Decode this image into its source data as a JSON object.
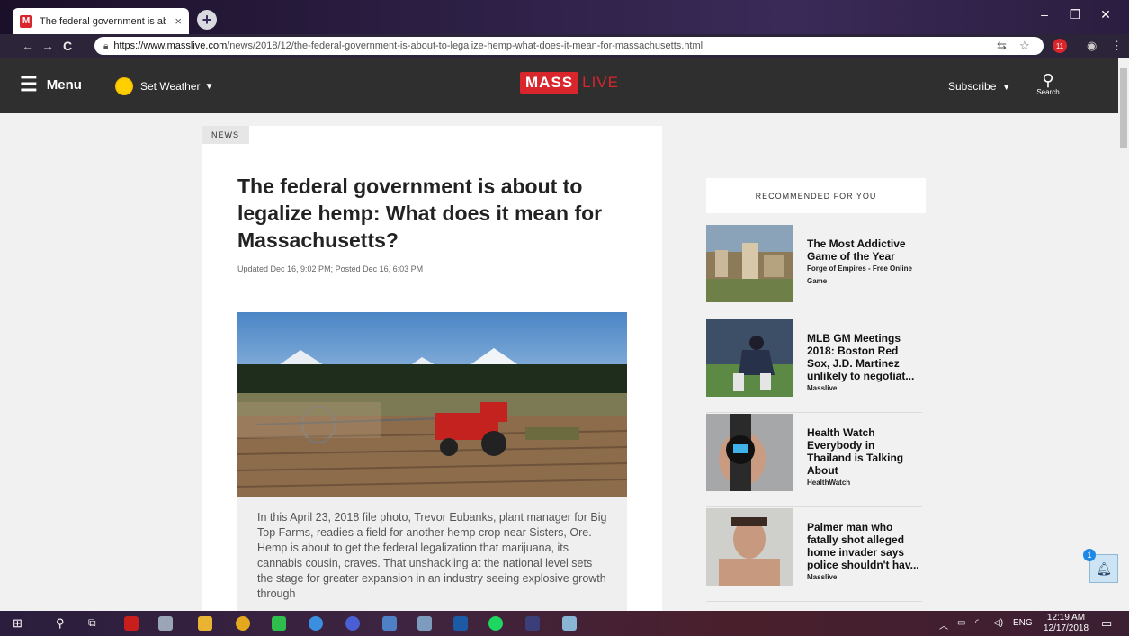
{
  "browser": {
    "tab_title": "The federal government is about",
    "tab_close": "×",
    "new_tab": "+",
    "url_host": "https://www.masslive.com",
    "url_path": "/news/2018/12/the-federal-government-is-about-to-legalize-hemp-what-does-it-mean-for-massachusetts.html",
    "extension_badge": "11"
  },
  "header": {
    "menu_label": "Menu",
    "weather_label": "Set Weather",
    "logo_mass": "MASS",
    "logo_live": "LIVE",
    "subscribe_label": "Subscribe",
    "search_label": "Search"
  },
  "article": {
    "section_tag": "NEWS",
    "headline": "The federal government is about to legalize hemp: What does it mean for Massachusetts?",
    "dateline": "Updated Dec 16, 9:02 PM; Posted Dec 16, 6:03 PM",
    "caption": "In this April 23, 2018 file photo, Trevor Eubanks, plant manager for Big Top Farms, readies a field for another hemp crop near Sisters, Ore. Hemp is about to get the federal legalization that marijuana, its cannabis cousin, craves. That unshackling at the national level sets the stage for greater expansion in an industry seeing explosive growth through"
  },
  "sidebar": {
    "heading": "RECOMMENDED FOR YOU",
    "items": [
      {
        "title": "The Most Addictive Game of the Year",
        "source": "Forge of Empires - Free Online Game"
      },
      {
        "title": "MLB GM Meetings 2018: Boston Red Sox, J.D. Martinez unlikely to negotiat...",
        "source": "Masslive"
      },
      {
        "title": "Health Watch Everybody in Thailand is Talking About",
        "source": "HealthWatch"
      },
      {
        "title": "Palmer man who fatally shot alleged home invader says police shouldn't hav...",
        "source": "Masslive"
      }
    ]
  },
  "notification": {
    "count": "1"
  },
  "taskbar": {
    "language": "ENG",
    "time": "12:19 AM",
    "date": "12/17/2018"
  }
}
